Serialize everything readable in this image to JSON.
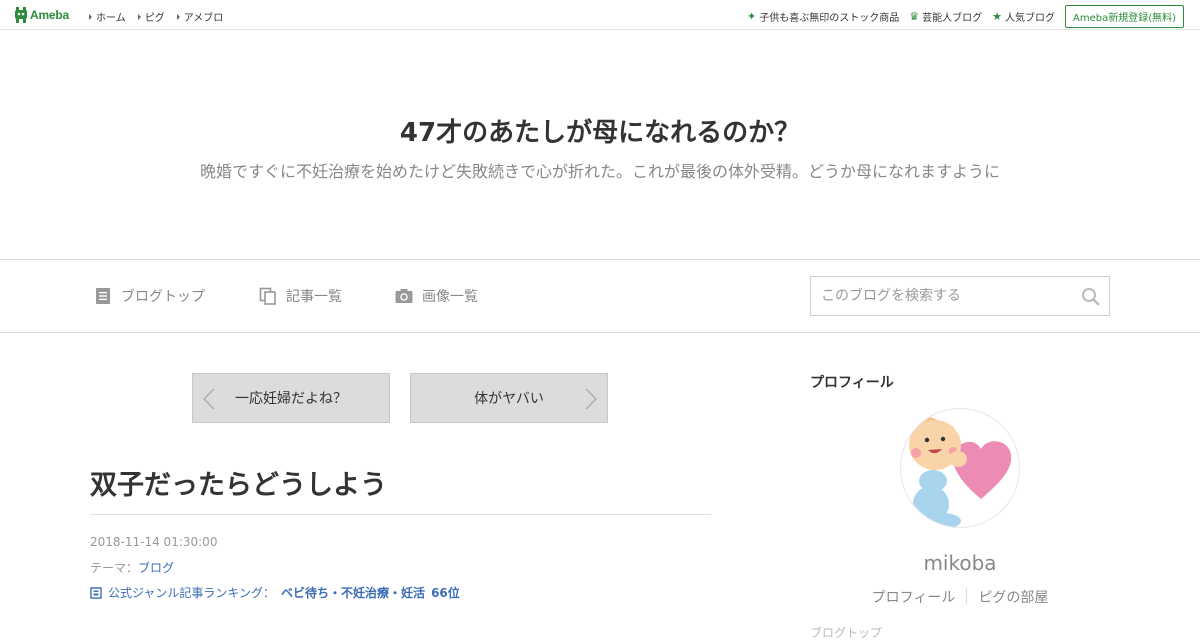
{
  "topbar": {
    "logo_text": "Ameba",
    "nav": [
      {
        "label": "ホーム"
      },
      {
        "label": "ピグ"
      },
      {
        "label": "アメブロ"
      }
    ],
    "right_links": [
      {
        "label": "子供も喜ぶ無印のストック商品",
        "icon": "sparkle-icon"
      },
      {
        "label": "芸能人ブログ",
        "icon": "crown-icon"
      },
      {
        "label": "人気ブログ",
        "icon": "star-icon"
      }
    ],
    "register_label": "Ameba新規登録(無料)"
  },
  "blog": {
    "title": "47才のあたしが母になれるのか？",
    "description": "晩婚ですぐに不妊治療を始めたけど失敗続きで心が折れた。これが最後の体外受精。どうか母になれますように"
  },
  "navbar": {
    "items": [
      {
        "label": "ブログトップ",
        "icon": "document-icon"
      },
      {
        "label": "記事一覧",
        "icon": "copy-icon"
      },
      {
        "label": "画像一覧",
        "icon": "camera-icon"
      }
    ],
    "search_placeholder": "このブログを検索する"
  },
  "pager": {
    "prev_label": "一応妊婦だよね？",
    "next_label": "体がヤバい"
  },
  "entry": {
    "title": "双子だったらどうしよう",
    "date": "2018-11-14 01:30:00",
    "theme_prefix": "テーマ：",
    "theme_link": "ブログ",
    "ranking_prefix": "公式ジャンル記事ランキング：",
    "ranking_genre": "ベビ待ち・不妊治療・妊活",
    "ranking_rank": "66位"
  },
  "sidebar": {
    "heading": "プロフィール",
    "name": "mikoba",
    "links": [
      "プロフィール",
      "ピグの部屋"
    ],
    "next_heading_partial": "ブログトップ"
  },
  "colors": {
    "brand_green": "#2d8c3c",
    "link_blue": "#3b6db5",
    "muted_text": "#888888"
  }
}
